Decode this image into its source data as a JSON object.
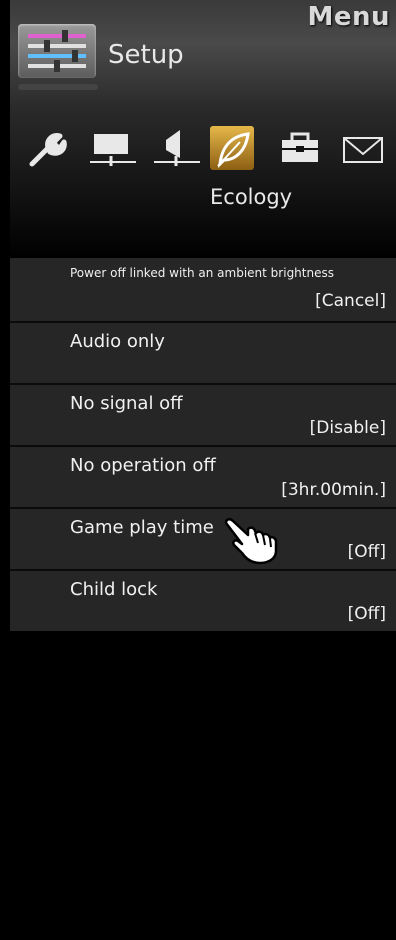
{
  "header": {
    "menu_title": "Menu",
    "section_label": "Setup",
    "section_icon": "setup-sliders-icon"
  },
  "tabs": {
    "icons": [
      "wrench-icon",
      "monitor-icon",
      "speaker-icon",
      "leaf-icon",
      "toolbox-icon",
      "envelope-icon"
    ],
    "selected_index": 3,
    "selected_label": "Ecology"
  },
  "settings": [
    {
      "label": "Power off linked with an ambient brightness",
      "value": "[Cancel]"
    },
    {
      "label": "Audio only",
      "value": ""
    },
    {
      "label": "No signal off",
      "value": "[Disable]"
    },
    {
      "label": "No operation off",
      "value": "[3hr.00min.]"
    },
    {
      "label": "Game play time",
      "value": "[Off]"
    },
    {
      "label": "Child lock",
      "value": "[Off]"
    }
  ],
  "cursor": {
    "icon": "pointing-hand-icon"
  },
  "colors": {
    "accent": "#c8962a",
    "row_bg": "#262626",
    "background": "#000000"
  }
}
